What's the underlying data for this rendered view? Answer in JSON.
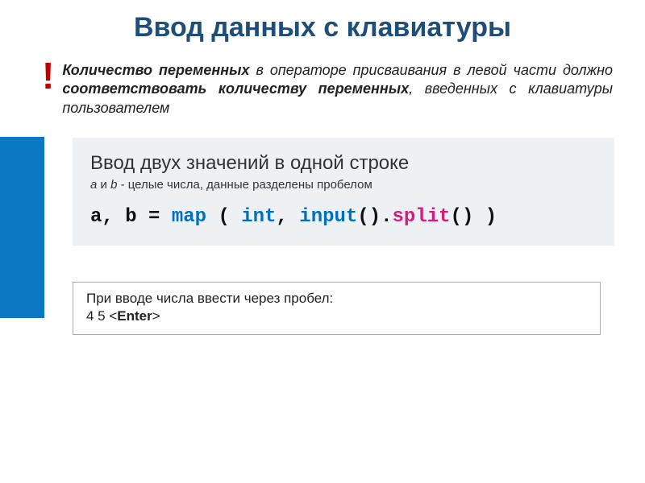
{
  "title": "Ввод данных с клавиатуры",
  "exclaim": "!",
  "note": {
    "part1_bold": "Количество переменных",
    "part2": " в операторе присваивания в левой части должно ",
    "part3_bold": "соответствовать количеству переменных",
    "part4": ", введенных с клавиатуры пользователем"
  },
  "info": {
    "title": "Ввод двух значений в одной строке",
    "sub_a": "a",
    "sub_and": " и ",
    "sub_b": "b",
    "sub_rest": " - целые числа, данные разделены пробелом",
    "code": {
      "p1": "a, b = ",
      "kw_map": "map",
      "p2": " ( ",
      "kw_int": "int",
      "p3": ", ",
      "kw_input": "input",
      "p4": "().",
      "fn_split": "split",
      "p5": "() )"
    }
  },
  "example": {
    "line1": "При вводе числа ввести через пробел:",
    "line2_prefix": "4  5  <",
    "line2_enter": "Enter",
    "line2_suffix": ">"
  }
}
